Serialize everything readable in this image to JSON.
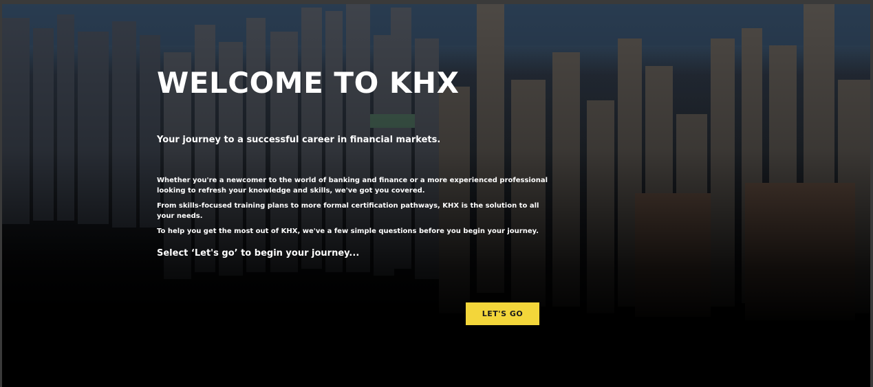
{
  "hero": {
    "title": "WELCOME TO KHX",
    "subtitle": "Your journey to a successful career in financial markets.",
    "paragraphs": [
      "Whether you're a newcomer to the world of banking and finance or a more experienced professional looking to refresh your knowledge and skills, we've got you covered.",
      "From skills-focused training plans to more formal certification pathways, KHX is the solution to all your needs.",
      "To help you get the most out of KHX, we've a few simple questions before you begin your journey."
    ],
    "cta_text": "Select ‘Let's go’ to begin your journey...",
    "button_label": "LET'S GO"
  },
  "colors": {
    "button": "#f3d63a",
    "text": "#ffffff",
    "background": "#000000"
  }
}
